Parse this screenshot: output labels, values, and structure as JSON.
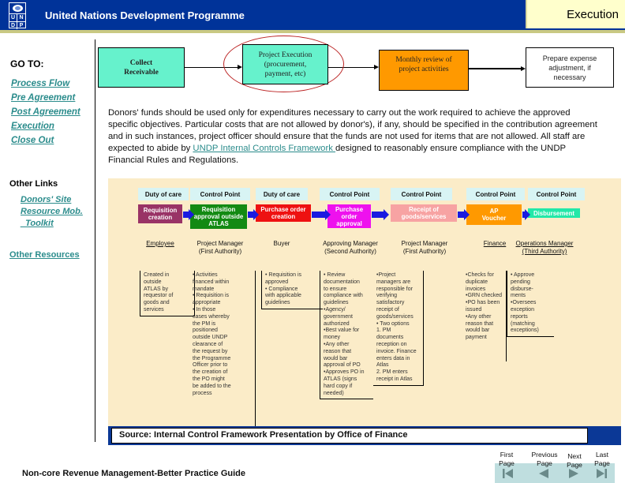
{
  "header": {
    "org_name": "United Nations Development Programme",
    "logo_letters": [
      "U",
      "N",
      "D",
      "P"
    ],
    "section_title": "Execution"
  },
  "sidebar": {
    "goto_title": "GO TO:",
    "goto_links": [
      "Process Flow",
      "Pre Agreement",
      "Post Agreement",
      "Execution",
      "Close Out"
    ],
    "other_links_title": "Other Links",
    "other_links": [
      "Donors' Site",
      "Resource Mob.",
      "_Toolkit"
    ],
    "other_resources": "Other Resources"
  },
  "process_flow": {
    "steps": [
      {
        "label": "Collect\nReceivable"
      },
      {
        "label": "Project Execution\n(procurement,\npayment, etc)",
        "highlighted": true
      },
      {
        "label": "Monthly review of\nproject activities"
      },
      {
        "label": "Prepare expense\nadjustment, if\nnecessary"
      }
    ]
  },
  "body": {
    "text_before_link": "Donors' funds should be used only for expenditures necessary to carry out the work required to achieve the approved specific objectives. Particular costs that are not allowed by donor's), if any, should be specified in the contribution agreement and in such instances,  project officer should ensure that the funds are not used for items that are not allowed. All staff are expected to abide by ",
    "link_text": "UNDP Internal Controls Framework ",
    "text_after_link": "designed to reasonably ensure compliance with the UNDP Financial Rules and Regulations."
  },
  "diagram": {
    "columns": [
      {
        "header": "Duty of care",
        "step": "Requisition\ncreation",
        "step_color": "#993366",
        "role": "Employee",
        "role_underlined": true,
        "note": "Created in\noutside\nATLAS by\nrequestor of\ngoods and\nservices"
      },
      {
        "header": "Control Point",
        "step": "Requisition\napproval outside\nATLAS",
        "step_color": "#138a13",
        "role": "Project Manager\n(First Authority)",
        "role_underlined": false,
        "note": "• Activities\nfinanced within\nmandate\n• Requisition is\nappropriate\n• In those\ncases whereby\nthe PM is\npositioned\noutside UNDP\nclearance of\nthe request by\nthe Programme\nOfficer prior to\nthe creation of\nthe PO might\nbe added to the\nprocess"
      },
      {
        "header": "Duty of care",
        "step": "Purchase order\ncreation",
        "step_color": "#ee1111",
        "role": "Buyer",
        "role_underlined": false,
        "note": "• Requisition is\napproved\n• Compliance\nwith applicable\nguidelines"
      },
      {
        "header": "Control Point",
        "step": "Purchase\norder\napproval",
        "step_color": "#ee11ee",
        "role": "Approving Manager\n(Second Authority)",
        "role_underlined": false,
        "note": "• Review\ndocumentation\nto ensure\ncompliance with\nguidelines\n•Agency/\ngovernment\nauthorized\n•Best value for\nmoney\n•Any other\nreason that\nwould bar\napproval of PO\n•Approves PO in\nATLAS (signs\nhard copy if\nneeded)"
      },
      {
        "header": "Control Point",
        "step": "Receipt of\ngoods/services",
        "step_color": "#f7a3a3",
        "role": "Project Manager\n(First  Authority)",
        "role_underlined": false,
        "note": "•Project\nmanagers are\nresponsible for\nverifying\nsatisfactory\nreceipt of\ngoods/services\n• Two options\n1. PM\ndocuments\nreception on\ninvoice. Finance\nenters data in\nAtlas\n2. PM enters\nreceipt in Atlas"
      },
      {
        "header": "Control Point",
        "step": "AP\nVoucher",
        "step_color": "#ff9900",
        "role": "Finance",
        "role_underlined": true,
        "note": "•Checks for\nduplicate\ninvoices\n•GRN checked\n•PO has been\nissued\n•Any other\nreason that\nwould bar\npayment"
      },
      {
        "header": "Control Point",
        "step": "Disbursement",
        "step_color": "#22e8a8",
        "role": "Operations Manager\n(Third Authority)",
        "role_underlined": true,
        "note": "• Approve\npending\ndisburse-\nments\n•Oversees\nexception\nreports\n(matching\nexceptions)"
      }
    ],
    "source": "Source: Internal Control Framework Presentation by Office of Finance"
  },
  "footer": {
    "title": "Non-core Revenue Management-Better Practice Guide",
    "nav": [
      {
        "label": "First\nPage",
        "icon": "first-page-icon"
      },
      {
        "label": "Previous\nPage",
        "icon": "previous-page-icon"
      },
      {
        "label": "Next\nPage",
        "icon": "next-page-icon"
      },
      {
        "label": "Last\nPage",
        "icon": "last-page-icon"
      }
    ]
  },
  "colors": {
    "header_blue": "#003399",
    "section_tab": "#ffffcc",
    "link_teal": "#2b8c8c",
    "flow_teal": "#66f2cc",
    "flow_orange": "#ff9900",
    "diagram_bg": "#fbecc8",
    "arrow_blue": "#1a1ae0"
  }
}
